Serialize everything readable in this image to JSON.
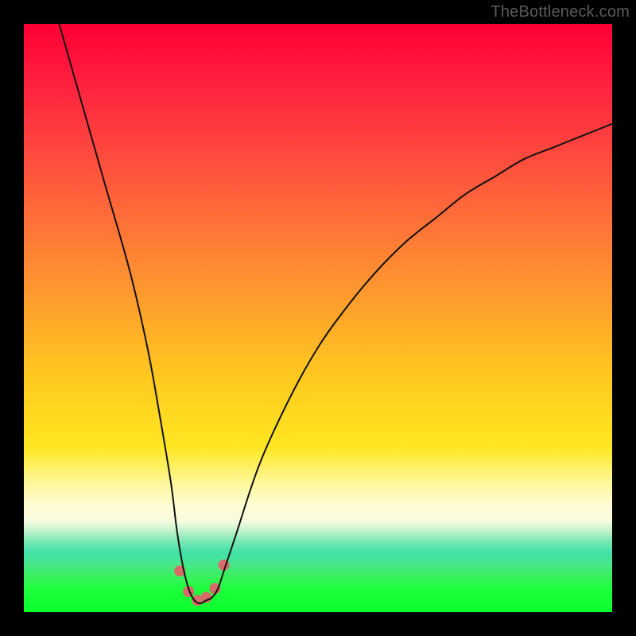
{
  "attribution": "TheBottleneck.com",
  "chart_data": {
    "type": "line",
    "title": "",
    "xlabel": "",
    "ylabel": "",
    "xlim": [
      0,
      100
    ],
    "ylim": [
      0,
      100
    ],
    "x": [
      6,
      10,
      14,
      18,
      21,
      23,
      25,
      26,
      27,
      28,
      29,
      30,
      31,
      32,
      33,
      34,
      36,
      40,
      45,
      50,
      55,
      60,
      65,
      70,
      75,
      80,
      85,
      90,
      95,
      100
    ],
    "values": [
      100,
      86,
      72,
      58,
      45,
      34,
      22,
      14,
      8,
      4,
      2,
      1.5,
      2,
      2.5,
      4,
      7,
      13,
      25,
      36,
      45,
      52,
      58,
      63,
      67,
      71,
      74,
      77,
      79,
      81,
      83
    ],
    "annotations": [
      {
        "label": "marker",
        "x": 26.5,
        "y": 7
      },
      {
        "label": "marker",
        "x": 28.0,
        "y": 3.5
      },
      {
        "label": "marker",
        "x": 29.5,
        "y": 2
      },
      {
        "label": "marker",
        "x": 31.0,
        "y": 2.5
      },
      {
        "label": "marker",
        "x": 32.5,
        "y": 4
      },
      {
        "label": "marker",
        "x": 34.0,
        "y": 8
      }
    ]
  },
  "colors": {
    "curve": "#111111",
    "marker": "#d86a6a",
    "frame_bg": "#000000"
  }
}
